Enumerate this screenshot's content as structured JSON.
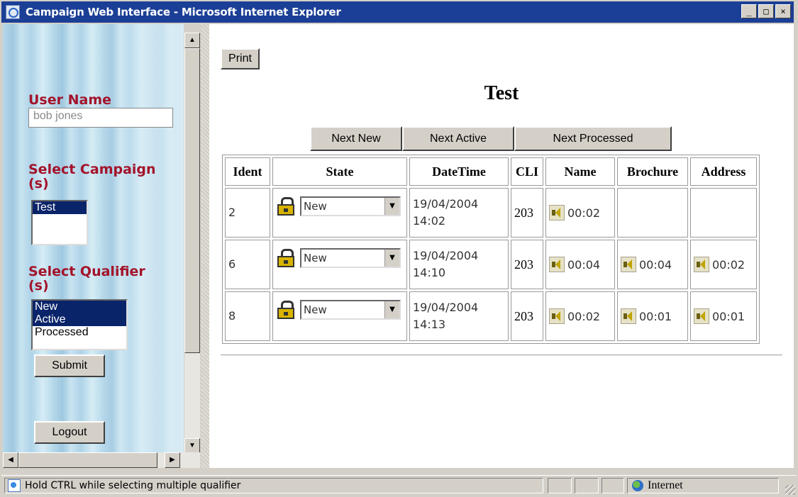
{
  "window": {
    "title": "Campaign Web Interface - Microsoft Internet Explorer",
    "min": "_",
    "max": "□",
    "close": "×"
  },
  "left": {
    "username_label": "User Name",
    "username_value": "bob jones",
    "campaign_label_1": "Select Campaign",
    "campaign_label_2": "(s)",
    "campaigns": [
      "Test"
    ],
    "qualifier_label_1": "Select Qualifier",
    "qualifier_label_2": "(s)",
    "qualifiers": [
      "New",
      "Active",
      "Processed"
    ],
    "submit": "Submit",
    "logout": "Logout"
  },
  "main": {
    "print": "Print",
    "heading": "Test",
    "nav": {
      "next_new": "Next New",
      "next_active": "Next Active",
      "next_processed": "Next Processed"
    },
    "columns": [
      "Ident",
      "State",
      "DateTime",
      "CLI",
      "Name",
      "Brochure",
      "Address"
    ],
    "rows": [
      {
        "ident": "2",
        "state": "New",
        "date": "19/04/2004",
        "time": "14:02",
        "cli": "203",
        "name": "00:02",
        "brochure": "",
        "address": ""
      },
      {
        "ident": "6",
        "state": "New",
        "date": "19/04/2004",
        "time": "14:10",
        "cli": "203",
        "name": "00:04",
        "brochure": "00:04",
        "address": "00:02"
      },
      {
        "ident": "8",
        "state": "New",
        "date": "19/04/2004",
        "time": "14:13",
        "cli": "203",
        "name": "00:02",
        "brochure": "00:01",
        "address": "00:01"
      }
    ]
  },
  "status": {
    "text": "Hold CTRL while selecting multiple qualifier",
    "zone": "Internet"
  }
}
